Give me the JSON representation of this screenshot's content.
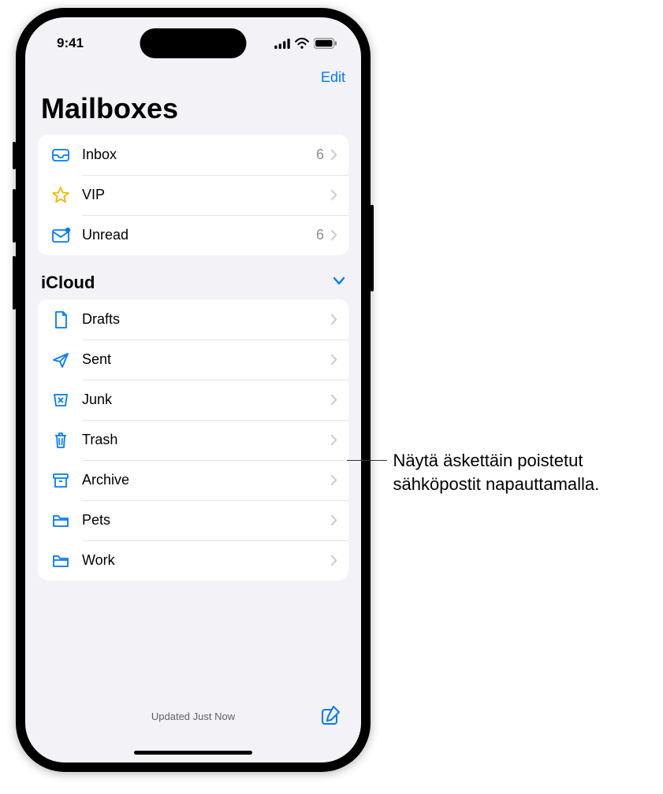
{
  "statusbar": {
    "time": "9:41"
  },
  "nav": {
    "edit": "Edit"
  },
  "header": {
    "title": "Mailboxes"
  },
  "mailboxes": [
    {
      "icon": "inbox",
      "label": "Inbox",
      "count": "6"
    },
    {
      "icon": "star",
      "label": "VIP",
      "count": ""
    },
    {
      "icon": "unread",
      "label": "Unread",
      "count": "6"
    }
  ],
  "section": {
    "title": "iCloud"
  },
  "folders": [
    {
      "icon": "doc",
      "label": "Drafts"
    },
    {
      "icon": "send",
      "label": "Sent"
    },
    {
      "icon": "junk",
      "label": "Junk"
    },
    {
      "icon": "trash",
      "label": "Trash"
    },
    {
      "icon": "archive",
      "label": "Archive"
    },
    {
      "icon": "folder",
      "label": "Pets"
    },
    {
      "icon": "folder",
      "label": "Work"
    }
  ],
  "toolbar": {
    "status": "Updated Just Now"
  },
  "callout": {
    "text": "Näytä äskettäin poistetut sähköpostit napauttamalla."
  }
}
